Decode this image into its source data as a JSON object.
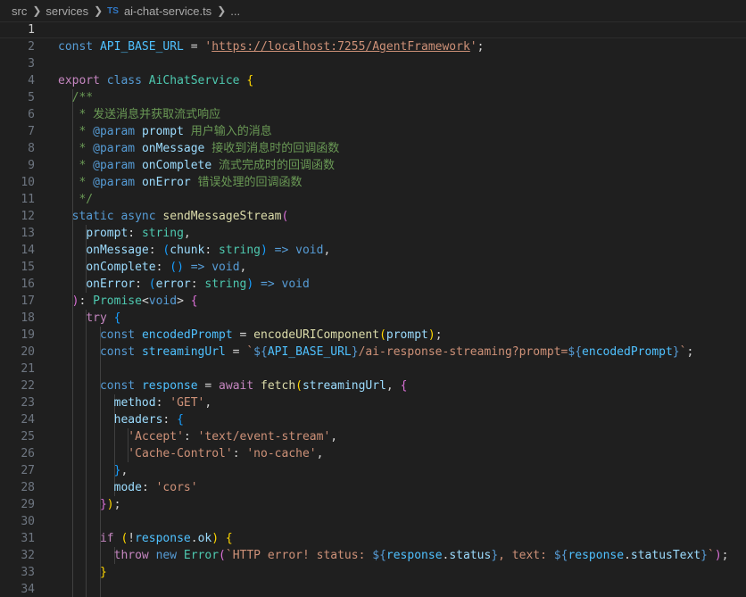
{
  "breadcrumb": {
    "items": [
      "src",
      "services",
      "ai-chat-service.ts",
      "..."
    ],
    "file_badge": "TS"
  },
  "editor": {
    "current_line": 1,
    "lines": [
      {
        "n": "1",
        "indent": 0,
        "tokens": []
      },
      {
        "n": "2",
        "indent": 0,
        "tokens": [
          [
            "const ",
            "kw"
          ],
          [
            "API_BASE_URL",
            "var"
          ],
          [
            " = ",
            "p"
          ],
          [
            "'",
            "str"
          ],
          [
            "https://localhost:7255/AgentFramework",
            "url"
          ],
          [
            "'",
            "str"
          ],
          [
            ";",
            "p"
          ]
        ]
      },
      {
        "n": "3",
        "indent": 0,
        "tokens": []
      },
      {
        "n": "4",
        "indent": 0,
        "tokens": [
          [
            "export ",
            "ctl"
          ],
          [
            "class ",
            "kw"
          ],
          [
            "AiChatService",
            "typ"
          ],
          [
            " ",
            "p"
          ],
          [
            "{",
            "b1"
          ]
        ]
      },
      {
        "n": "5",
        "indent": 2,
        "tokens": [
          [
            "/**",
            "com"
          ]
        ]
      },
      {
        "n": "6",
        "indent": 2,
        "tokens": [
          [
            " * 发送消息并获取流式响应",
            "com"
          ]
        ]
      },
      {
        "n": "7",
        "indent": 2,
        "tokens": [
          [
            " * ",
            "com"
          ],
          [
            "@param",
            "kw"
          ],
          [
            " ",
            "com"
          ],
          [
            "prompt",
            "par"
          ],
          [
            " 用户输入的消息",
            "com"
          ]
        ]
      },
      {
        "n": "8",
        "indent": 2,
        "tokens": [
          [
            " * ",
            "com"
          ],
          [
            "@param",
            "kw"
          ],
          [
            " ",
            "com"
          ],
          [
            "onMessage",
            "par"
          ],
          [
            " 接收到消息时的回调函数",
            "com"
          ]
        ]
      },
      {
        "n": "9",
        "indent": 2,
        "tokens": [
          [
            " * ",
            "com"
          ],
          [
            "@param",
            "kw"
          ],
          [
            " ",
            "com"
          ],
          [
            "onComplete",
            "par"
          ],
          [
            " 流式完成时的回调函数",
            "com"
          ]
        ]
      },
      {
        "n": "10",
        "indent": 2,
        "tokens": [
          [
            " * ",
            "com"
          ],
          [
            "@param",
            "kw"
          ],
          [
            " ",
            "com"
          ],
          [
            "onError",
            "par"
          ],
          [
            " 错误处理的回调函数",
            "com"
          ]
        ]
      },
      {
        "n": "11",
        "indent": 2,
        "tokens": [
          [
            " */",
            "com"
          ]
        ]
      },
      {
        "n": "12",
        "indent": 2,
        "tokens": [
          [
            "static ",
            "kw"
          ],
          [
            "async ",
            "kw"
          ],
          [
            "sendMessageStream",
            "fn"
          ],
          [
            "(",
            "b2"
          ]
        ]
      },
      {
        "n": "13",
        "indent": 4,
        "tokens": [
          [
            "prompt",
            "par"
          ],
          [
            ": ",
            "p"
          ],
          [
            "string",
            "typ"
          ],
          [
            ",",
            "p"
          ]
        ]
      },
      {
        "n": "14",
        "indent": 4,
        "tokens": [
          [
            "onMessage",
            "par"
          ],
          [
            ": ",
            "p"
          ],
          [
            "(",
            "b3"
          ],
          [
            "chunk",
            "par"
          ],
          [
            ": ",
            "p"
          ],
          [
            "string",
            "typ"
          ],
          [
            ")",
            "b3"
          ],
          [
            " ",
            "p"
          ],
          [
            "=>",
            "kw"
          ],
          [
            " ",
            "p"
          ],
          [
            "void",
            "kw"
          ],
          [
            ",",
            "p"
          ]
        ]
      },
      {
        "n": "15",
        "indent": 4,
        "tokens": [
          [
            "onComplete",
            "par"
          ],
          [
            ": ",
            "p"
          ],
          [
            "()",
            "b3"
          ],
          [
            " ",
            "p"
          ],
          [
            "=>",
            "kw"
          ],
          [
            " ",
            "p"
          ],
          [
            "void",
            "kw"
          ],
          [
            ",",
            "p"
          ]
        ]
      },
      {
        "n": "16",
        "indent": 4,
        "tokens": [
          [
            "onError",
            "par"
          ],
          [
            ": ",
            "p"
          ],
          [
            "(",
            "b3"
          ],
          [
            "error",
            "par"
          ],
          [
            ": ",
            "p"
          ],
          [
            "string",
            "typ"
          ],
          [
            ")",
            "b3"
          ],
          [
            " ",
            "p"
          ],
          [
            "=>",
            "kw"
          ],
          [
            " ",
            "p"
          ],
          [
            "void",
            "kw"
          ]
        ]
      },
      {
        "n": "17",
        "indent": 2,
        "tokens": [
          [
            ")",
            "b2"
          ],
          [
            ": ",
            "p"
          ],
          [
            "Promise",
            "typ"
          ],
          [
            "<",
            "p"
          ],
          [
            "void",
            "kw"
          ],
          [
            ">",
            "p"
          ],
          [
            " ",
            "p"
          ],
          [
            "{",
            "b2"
          ]
        ]
      },
      {
        "n": "18",
        "indent": 4,
        "tokens": [
          [
            "try ",
            "ctl"
          ],
          [
            "{",
            "b3"
          ]
        ]
      },
      {
        "n": "19",
        "indent": 6,
        "tokens": [
          [
            "const ",
            "kw"
          ],
          [
            "encodedPrompt",
            "var"
          ],
          [
            " = ",
            "p"
          ],
          [
            "encodeURIComponent",
            "fn"
          ],
          [
            "(",
            "b1"
          ],
          [
            "prompt",
            "par"
          ],
          [
            ")",
            "b1"
          ],
          [
            ";",
            "p"
          ]
        ]
      },
      {
        "n": "20",
        "indent": 6,
        "tokens": [
          [
            "const ",
            "kw"
          ],
          [
            "streamingUrl",
            "var"
          ],
          [
            " = ",
            "p"
          ],
          [
            "`",
            "str"
          ],
          [
            "${",
            "kw"
          ],
          [
            "API_BASE_URL",
            "var"
          ],
          [
            "}",
            "kw"
          ],
          [
            "/ai-response-streaming?prompt=",
            "str"
          ],
          [
            "${",
            "kw"
          ],
          [
            "encodedPrompt",
            "var"
          ],
          [
            "}",
            "kw"
          ],
          [
            "`",
            "str"
          ],
          [
            ";",
            "p"
          ]
        ]
      },
      {
        "n": "21",
        "indent": 6,
        "tokens": []
      },
      {
        "n": "22",
        "indent": 6,
        "tokens": [
          [
            "const ",
            "kw"
          ],
          [
            "response",
            "var"
          ],
          [
            " = ",
            "p"
          ],
          [
            "await ",
            "ctl"
          ],
          [
            "fetch",
            "fn"
          ],
          [
            "(",
            "b1"
          ],
          [
            "streamingUrl",
            "par"
          ],
          [
            ", ",
            "p"
          ],
          [
            "{",
            "b2"
          ]
        ]
      },
      {
        "n": "23",
        "indent": 8,
        "tokens": [
          [
            "method",
            "par"
          ],
          [
            ": ",
            "p"
          ],
          [
            "'GET'",
            "str"
          ],
          [
            ",",
            "p"
          ]
        ]
      },
      {
        "n": "24",
        "indent": 8,
        "tokens": [
          [
            "headers",
            "par"
          ],
          [
            ": ",
            "p"
          ],
          [
            "{",
            "b3"
          ]
        ]
      },
      {
        "n": "25",
        "indent": 10,
        "tokens": [
          [
            "'Accept'",
            "str"
          ],
          [
            ": ",
            "p"
          ],
          [
            "'text/event-stream'",
            "str"
          ],
          [
            ",",
            "p"
          ]
        ]
      },
      {
        "n": "26",
        "indent": 10,
        "tokens": [
          [
            "'Cache-Control'",
            "str"
          ],
          [
            ": ",
            "p"
          ],
          [
            "'no-cache'",
            "str"
          ],
          [
            ",",
            "p"
          ]
        ]
      },
      {
        "n": "27",
        "indent": 8,
        "tokens": [
          [
            "}",
            "b3"
          ],
          [
            ",",
            "p"
          ]
        ]
      },
      {
        "n": "28",
        "indent": 8,
        "tokens": [
          [
            "mode",
            "par"
          ],
          [
            ": ",
            "p"
          ],
          [
            "'cors'",
            "str"
          ]
        ]
      },
      {
        "n": "29",
        "indent": 6,
        "tokens": [
          [
            "}",
            "b2"
          ],
          [
            ")",
            "b1"
          ],
          [
            ";",
            "p"
          ]
        ]
      },
      {
        "n": "30",
        "indent": 6,
        "tokens": []
      },
      {
        "n": "31",
        "indent": 6,
        "tokens": [
          [
            "if ",
            "ctl"
          ],
          [
            "(",
            "b1"
          ],
          [
            "!",
            "p"
          ],
          [
            "response",
            "var"
          ],
          [
            ".",
            "p"
          ],
          [
            "ok",
            "par"
          ],
          [
            ")",
            "b1"
          ],
          [
            " ",
            "p"
          ],
          [
            "{",
            "b1"
          ]
        ]
      },
      {
        "n": "32",
        "indent": 8,
        "tokens": [
          [
            "throw ",
            "ctl"
          ],
          [
            "new ",
            "kw"
          ],
          [
            "Error",
            "typ"
          ],
          [
            "(",
            "b2"
          ],
          [
            "`HTTP error! status: ",
            "str"
          ],
          [
            "${",
            "kw"
          ],
          [
            "response",
            "var"
          ],
          [
            ".",
            "p"
          ],
          [
            "status",
            "par"
          ],
          [
            "}",
            "kw"
          ],
          [
            ", text: ",
            "str"
          ],
          [
            "${",
            "kw"
          ],
          [
            "response",
            "var"
          ],
          [
            ".",
            "p"
          ],
          [
            "statusText",
            "par"
          ],
          [
            "}",
            "kw"
          ],
          [
            "`",
            "str"
          ],
          [
            ")",
            "b2"
          ],
          [
            ";",
            "p"
          ]
        ]
      },
      {
        "n": "33",
        "indent": 6,
        "tokens": [
          [
            "}",
            "b1"
          ]
        ]
      },
      {
        "n": "34",
        "indent": 6,
        "tokens": []
      }
    ]
  }
}
